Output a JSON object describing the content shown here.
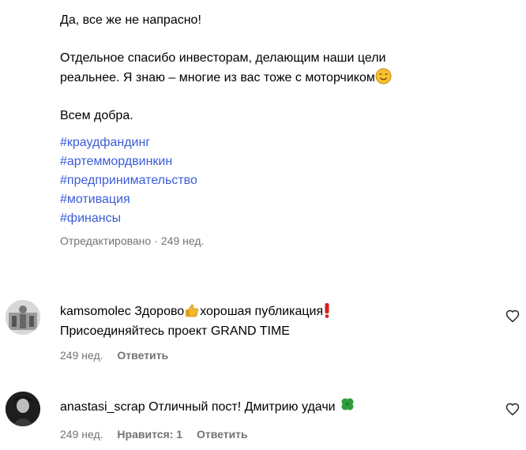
{
  "post": {
    "line1": "Да, все же не напрасно!",
    "line2a": "Отдельное спасибо инвесторам, делающим наши цели",
    "line2b": "реальнее. Я знаю – многие из вас тоже с моторчиком",
    "line3": "Всем добра.",
    "hashtags": [
      "#краудфандинг",
      "#артеммордвинкин",
      "#предпринимательство",
      "#мотивация",
      "#финансы"
    ],
    "edited": "Отредактировано",
    "dot": "·",
    "time": "249 нед."
  },
  "comments": [
    {
      "username": "kamsomolec",
      "text_a": "Здорово",
      "text_b": "хорошая публикация",
      "text_c": "Присоединяйтесь проект GRAND TIME",
      "time": "249 нед.",
      "reply": "Ответить",
      "icons": [
        "thumbs-up-icon",
        "exclamation-icon",
        "heart-icon"
      ]
    },
    {
      "username": "anastasi_scrap",
      "text_a": "Отличный пост! Дмитрию удачи",
      "time": "249 нед.",
      "likes": "Нравится: 1",
      "reply": "Ответить",
      "icons": [
        "four-leaf-clover-icon",
        "heart-icon"
      ]
    }
  ],
  "colors": {
    "hashtag": "#3b5cd9",
    "meta": "#737373"
  }
}
